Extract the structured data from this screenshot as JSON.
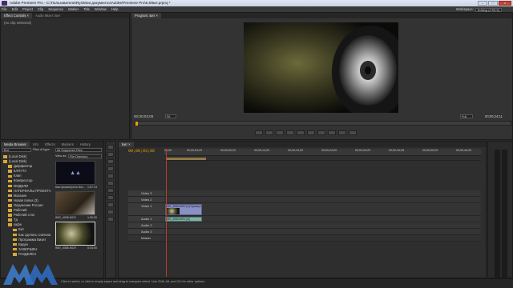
{
  "window": {
    "title": "Adobe Premiere Pro - C:\\Пользователи\\Rys\\Мои документы\\Adobe\\Premiere Pro\\5.5\\Бит.prproj *"
  },
  "menu": [
    "File",
    "Edit",
    "Project",
    "Clip",
    "Sequence",
    "Marker",
    "Title",
    "Window",
    "Help"
  ],
  "workspace": {
    "label": "Workspace:",
    "value": "Editing (CS5.5)"
  },
  "effect_controls": {
    "tabs": [
      "Effect Controls ×",
      "Audio Mixer: Бит"
    ],
    "status": "(no clip selected)"
  },
  "program": {
    "tab": "Program: Бит ×",
    "timecode": "00;00;03;06",
    "fit": "Fit",
    "full": "Full",
    "duration": "00;00;24;11"
  },
  "project": {
    "tabs": [
      "Media Browser",
      "Info",
      "Effects",
      "Markers",
      "History"
    ],
    "browser_path": "Все",
    "files_of_type": "Files of type:",
    "files_filter": "All Supported Files",
    "view_as": "View as:",
    "view_value": "File Directory",
    "folders": [
      "(Local Disk)",
      "(Local Disk)",
      "Диффиятор",
      "КАПУТА",
      "Клип",
      "Компрессор",
      "МОДЕЛИ",
      "НАТЕРИАЛЫ ПРОЕКТА",
      "Магазин",
      "Новая папка (2)",
      "Окружение Россия",
      "Рабочий",
      "Рабочий стол",
      "Тд",
      "кафе",
      "Бит",
      "Как сделать сначала",
      "Программа Визит",
      "Видео",
      "ЗАВЕРШЕН",
      "РАЗДЕЛЕН"
    ],
    "thumbs": [
      {
        "label": "Как просмотреть Бит...",
        "duration": "1:57:13"
      },
      {
        "label": "IMG_4065.MOV",
        "duration": "1:00:00"
      },
      {
        "label": "IMG_4066.MOV",
        "duration": "0:03:00"
      }
    ]
  },
  "timeline": {
    "tab": "Бит ×",
    "timecode": "00;00;03;06",
    "ruler": [
      "00;00",
      "00;00;04;29",
      "00;00;09;29",
      "00;00;14;29",
      "00;00;19;29",
      "00;00;24;29",
      "00;00;29;29",
      "00;00;34;28",
      "00;00;39;29",
      "00;00;44;29"
    ],
    "tracks": [
      "Video 3",
      "Video 2",
      "Video 1",
      "Audio 1",
      "Audio 2",
      "Audio 3",
      "Master"
    ],
    "clip_video": "IMG_4066.MOV [V] Opacity:Opacity ▾",
    "clip_audio": "IMG_4066.MOV [A]"
  },
  "status_bar": "Click to select, or click in empty space and drag to marquee select. Use Shift, Alt, and Ctrl for other options.",
  "colors": {
    "accent": "#e8a300",
    "playhead": "#c23a2a",
    "clip_video": "#8a8fc4",
    "clip_audio": "#7fb0a6"
  }
}
